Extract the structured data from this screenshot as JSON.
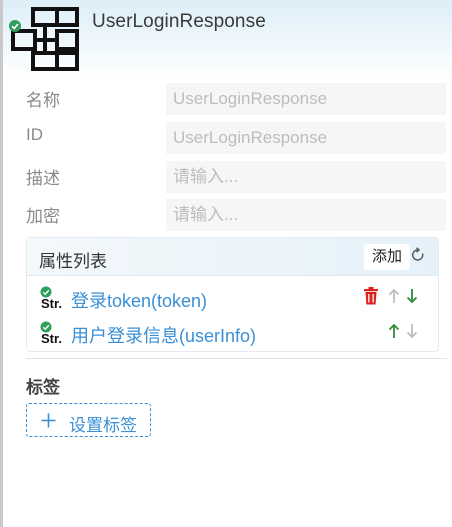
{
  "header": {
    "title": "UserLoginResponse",
    "icon": "entity-structure-icon",
    "status_icon": "check-badge-icon",
    "status_color": "#2e9e5b"
  },
  "form": {
    "name": {
      "label": "名称",
      "value": "UserLoginResponse"
    },
    "id": {
      "label": "ID",
      "value": "UserLoginResponse"
    },
    "description": {
      "label": "描述",
      "placeholder": "请输入..."
    },
    "encryption": {
      "label": "加密",
      "placeholder": "请输入..."
    }
  },
  "attributes": {
    "title": "属性列表",
    "add_label": "添加",
    "items": [
      {
        "label": "登录token(token)",
        "type_badge": "Str.",
        "deletable": true,
        "up_enabled": false,
        "down_enabled": true
      },
      {
        "label": "用户登录信息(userInfo)",
        "type_badge": "Str.",
        "deletable": false,
        "up_enabled": true,
        "down_enabled": false
      }
    ]
  },
  "tags": {
    "title": "标签",
    "set_label": "设置标签"
  },
  "colors": {
    "link": "#3a8fd6",
    "delete": "#e02020",
    "arrow_active": "#2e8b3a",
    "arrow_disabled": "#bdbdbd"
  }
}
